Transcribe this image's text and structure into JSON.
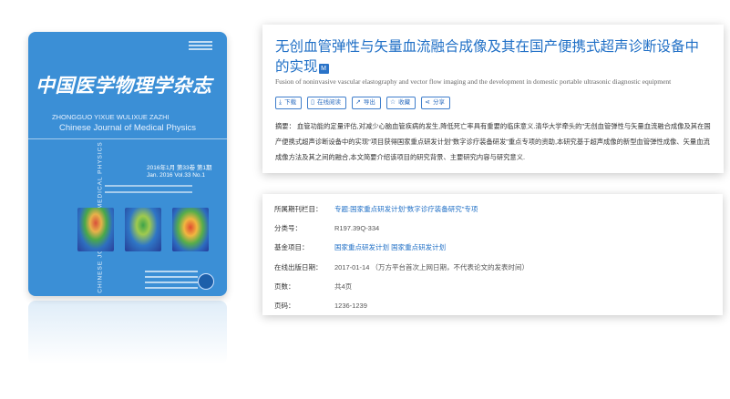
{
  "cover": {
    "cn_title": "中国医学物理学杂志",
    "en_line1": "ZHONGGUO YIXUE WULIXUE ZAZHI",
    "en_line2": "Chinese Journal of Medical Physics",
    "issue_line1": "2016年1月    第33卷    第1期",
    "issue_line2": "Jan. 2016    Vol.33    No.1",
    "spine_text": "CHINESE JOURNAL OF MEDICAL PHYSICS"
  },
  "article": {
    "title": "无创血管弹性与矢量血流融合成像及其在国产便携式超声诊断设备中的实现",
    "title_icon": "M",
    "title_en": "Fusion of noninvasive vascular elastography and vector flow imaging and the development in domestic portable ultrasonic diagnostic equipment",
    "actions": [
      {
        "label": "下载",
        "icon": "download-icon",
        "glyph": "⤓"
      },
      {
        "label": "在线阅读",
        "icon": "book-icon",
        "glyph": "▯"
      },
      {
        "label": "导出",
        "icon": "export-icon",
        "glyph": "↗"
      },
      {
        "label": "收藏",
        "icon": "star-icon",
        "glyph": "☆"
      },
      {
        "label": "分享",
        "icon": "share-icon",
        "glyph": "⋖"
      }
    ],
    "abstract_label": "摘要：",
    "abstract_text": "血管功能的定量评估,对减少心脑血管疾病的发生,降低死亡率具有重要的临床意义.清华大学牵头的\"无创血管弹性与矢量血流融合成像及其在国产便携式超声诊断设备中的实现\"项目获得国家重点研发计划\"数字诊疗装备研发\"重点专项的资助,本研究基于超声成像的新型血管弹性成像、矢量血流成像方法及其之间的融合,本文简要介绍该项目的研究背景、主要研究内容与研究意义."
  },
  "meta": {
    "rows": [
      {
        "label": "所属期刊栏目：",
        "value": "专题:国家重点研发计划\"数字诊疗装备研究\"专项",
        "link": true
      },
      {
        "label": "分类号：",
        "value": "R197.39Q-334",
        "link": false
      },
      {
        "label": "基金项目：",
        "value": "国家重点研发计划 国家重点研发计划",
        "link": true
      },
      {
        "label": "在线出版日期：",
        "value": "2017-01-14  （万方平台首次上网日期，不代表论文的发表时间）",
        "link": false
      },
      {
        "label": "页数：",
        "value": "共4页",
        "link": false
      },
      {
        "label": "页码：",
        "value": "1236-1239",
        "link": false
      }
    ]
  },
  "colors": {
    "cover_blue": "#3b8fd6",
    "link_blue": "#1f6fc6",
    "text_gray": "#333333"
  }
}
